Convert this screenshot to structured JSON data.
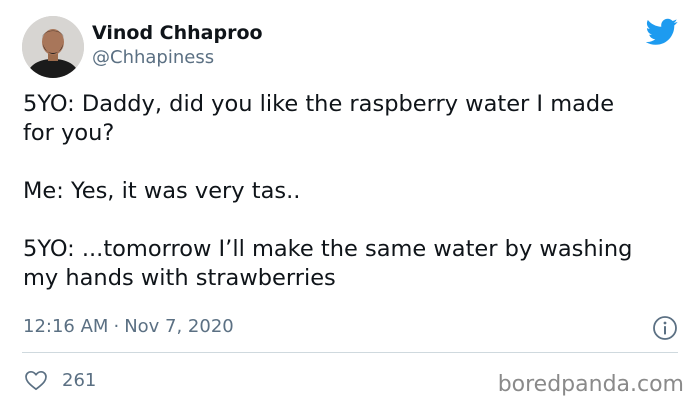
{
  "author": {
    "name": "Vinod Chhaproo",
    "handle": "@Chhapiness",
    "avatar_icon": "user-avatar-photo"
  },
  "platform_icon": "twitter-bird-icon",
  "brand_color": "#1d9bf0",
  "tweet": {
    "paragraphs": [
      "5YO: Daddy, did you like the raspberry water I made\nfor you?",
      "Me: Yes, it was very tas..",
      "5YO: ...tomorrow I’ll make the same water by washing\nmy hands with strawberries"
    ],
    "time": "12:16 AM",
    "separator": "·",
    "date": "Nov 7, 2020"
  },
  "metrics": {
    "like_icon": "heart-icon",
    "likes": "261",
    "info_icon": "info-icon"
  },
  "watermark": "boredpanda.com"
}
